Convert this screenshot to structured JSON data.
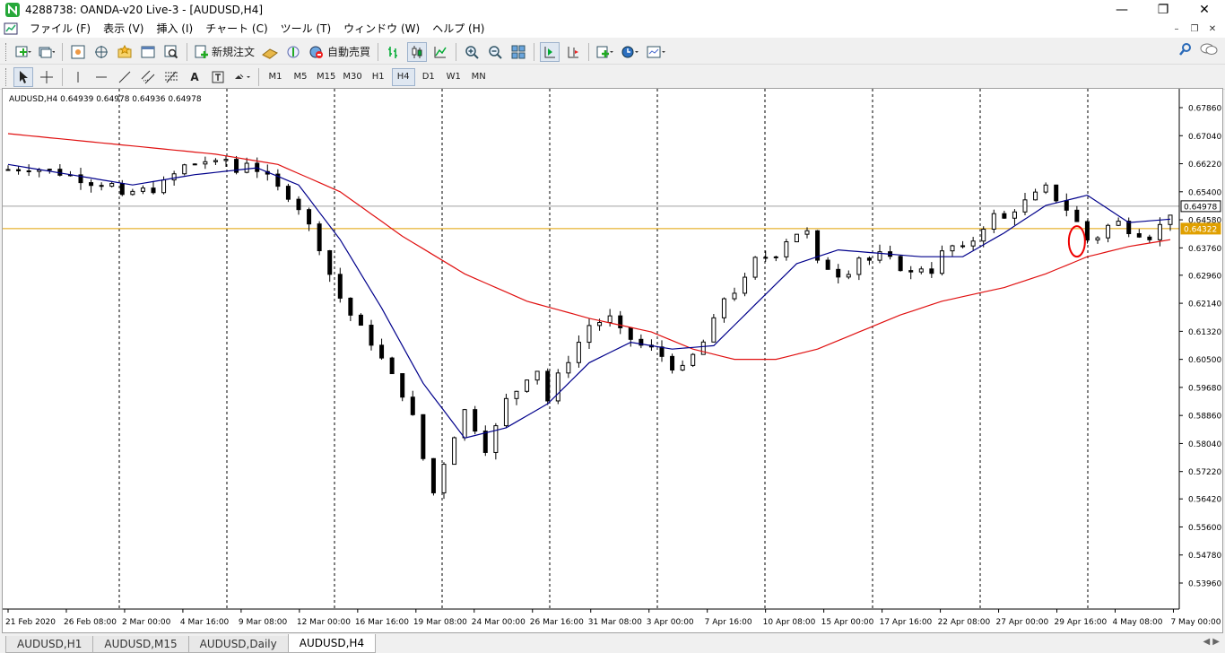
{
  "window": {
    "title": "4288738: OANDA-v20 Live-3 - [AUDUSD,H4]",
    "minimize": "—",
    "maximize": "❐",
    "close": "✕"
  },
  "menu": {
    "items": [
      "ファイル (F)",
      "表示 (V)",
      "挿入 (I)",
      "チャート (C)",
      "ツール (T)",
      "ウィンドウ (W)",
      "ヘルプ (H)"
    ],
    "mdi_minimize": "–",
    "mdi_restore": "❐",
    "mdi_close": "✕"
  },
  "toolbar1": {
    "new_order_label": "新規注文",
    "auto_trading_label": "自動売買"
  },
  "toolbar2": {
    "timeframes": [
      "M1",
      "M5",
      "M15",
      "M30",
      "H1",
      "H4",
      "D1",
      "W1",
      "MN"
    ],
    "active_timeframe": "H4",
    "text_tool": "A"
  },
  "chart_data": {
    "type": "candlestick",
    "symbol_info": "AUDUSD,H4  0.64939 0.64978 0.64936 0.64978",
    "y_ticks": [
      "0.67860",
      "0.67040",
      "0.66220",
      "0.65400",
      "0.64580",
      "0.63760",
      "0.62960",
      "0.62140",
      "0.61320",
      "0.60500",
      "0.59680",
      "0.58860",
      "0.58040",
      "0.57220",
      "0.56420",
      "0.55600",
      "0.54780",
      "0.53960"
    ],
    "ylim": [
      0.5396,
      0.6786
    ],
    "x_ticks": [
      "21 Feb 2020",
      "26 Feb 08:00",
      "2 Mar 00:00",
      "4 Mar 16:00",
      "9 Mar 08:00",
      "12 Mar 00:00",
      "16 Mar 16:00",
      "19 Mar 08:00",
      "24 Mar 00:00",
      "26 Mar 16:00",
      "31 Mar 08:00",
      "3 Apr 00:00",
      "7 Apr 16:00",
      "10 Apr 08:00",
      "15 Apr 00:00",
      "17 Apr 16:00",
      "22 Apr 08:00",
      "27 Apr 00:00",
      "29 Apr 16:00",
      "4 May 08:00",
      "7 May 00:00"
    ],
    "current_price_label": "0.64978",
    "hline_price_label": "0.64322",
    "current_price": 0.64978,
    "hline_price": 0.64322,
    "ma_fast_color": "#00008b",
    "ma_slow_color": "#e01010",
    "hline_color": "#e0a000",
    "price_line_color": "#a0a0a0",
    "close_path": [
      [
        0,
        0.6605
      ],
      [
        2,
        0.661
      ],
      [
        4,
        0.6602
      ],
      [
        6,
        0.6588
      ],
      [
        8,
        0.6568
      ],
      [
        10,
        0.656
      ],
      [
        11,
        0.652
      ],
      [
        12,
        0.654
      ],
      [
        14,
        0.6548
      ],
      [
        15,
        0.6565
      ],
      [
        17,
        0.6615
      ],
      [
        19,
        0.663
      ],
      [
        20,
        0.662
      ],
      [
        21,
        0.6635
      ],
      [
        22,
        0.6598
      ],
      [
        23,
        0.663
      ],
      [
        24,
        0.6605
      ],
      [
        25,
        0.658
      ],
      [
        26,
        0.655
      ],
      [
        27,
        0.653
      ],
      [
        28,
        0.6495
      ],
      [
        29,
        0.644
      ],
      [
        30,
        0.638
      ],
      [
        31,
        0.63
      ],
      [
        32,
        0.623
      ],
      [
        33,
        0.618
      ],
      [
        34,
        0.614
      ],
      [
        35,
        0.61
      ],
      [
        36,
        0.605
      ],
      [
        37,
        0.6
      ],
      [
        38,
        0.595
      ],
      [
        39,
        0.588
      ],
      [
        40,
        0.576
      ],
      [
        41,
        0.566
      ],
      [
        42,
        0.575
      ],
      [
        43,
        0.583
      ],
      [
        44,
        0.59
      ],
      [
        45,
        0.585
      ],
      [
        46,
        0.579
      ],
      [
        47,
        0.585
      ],
      [
        48,
        0.593
      ],
      [
        49,
        0.596
      ],
      [
        50,
        0.6
      ],
      [
        51,
        0.602
      ],
      [
        52,
        0.593
      ],
      [
        53,
        0.6
      ],
      [
        54,
        0.605
      ],
      [
        55,
        0.61
      ],
      [
        56,
        0.615
      ],
      [
        57,
        0.616
      ],
      [
        58,
        0.617
      ],
      [
        59,
        0.613
      ],
      [
        60,
        0.611
      ],
      [
        61,
        0.609
      ],
      [
        62,
        0.608
      ],
      [
        63,
        0.606
      ],
      [
        64,
        0.603
      ],
      [
        65,
        0.602
      ],
      [
        66,
        0.606
      ],
      [
        67,
        0.61
      ],
      [
        68,
        0.616
      ],
      [
        69,
        0.623
      ],
      [
        70,
        0.625
      ],
      [
        71,
        0.628
      ],
      [
        72,
        0.634
      ],
      [
        73,
        0.635
      ],
      [
        74,
        0.636
      ],
      [
        75,
        0.64
      ],
      [
        76,
        0.642
      ],
      [
        77,
        0.642
      ],
      [
        78,
        0.633
      ],
      [
        79,
        0.632
      ],
      [
        80,
        0.63
      ],
      [
        81,
        0.631
      ],
      [
        82,
        0.635
      ],
      [
        83,
        0.634
      ],
      [
        84,
        0.6355
      ],
      [
        85,
        0.634
      ],
      [
        86,
        0.632
      ],
      [
        87,
        0.63
      ],
      [
        88,
        0.632
      ],
      [
        89,
        0.631
      ],
      [
        90,
        0.636
      ],
      [
        91,
        0.638
      ],
      [
        92,
        0.637
      ],
      [
        93,
        0.64
      ],
      [
        94,
        0.644
      ],
      [
        95,
        0.647
      ],
      [
        96,
        0.646
      ],
      [
        97,
        0.649
      ],
      [
        98,
        0.651
      ],
      [
        99,
        0.653
      ],
      [
        100,
        0.655
      ],
      [
        101,
        0.652
      ],
      [
        102,
        0.649
      ],
      [
        103,
        0.645
      ],
      [
        104,
        0.64
      ],
      [
        105,
        0.641
      ],
      [
        106,
        0.644
      ],
      [
        107,
        0.645
      ],
      [
        108,
        0.643
      ],
      [
        109,
        0.642
      ],
      [
        110,
        0.641
      ],
      [
        111,
        0.644
      ],
      [
        112,
        0.648
      ]
    ],
    "ma_fast": [
      [
        0,
        0.662
      ],
      [
        6,
        0.659
      ],
      [
        12,
        0.656
      ],
      [
        18,
        0.659
      ],
      [
        24,
        0.661
      ],
      [
        28,
        0.656
      ],
      [
        32,
        0.64
      ],
      [
        36,
        0.62
      ],
      [
        40,
        0.598
      ],
      [
        44,
        0.582
      ],
      [
        48,
        0.585
      ],
      [
        52,
        0.592
      ],
      [
        56,
        0.604
      ],
      [
        60,
        0.61
      ],
      [
        64,
        0.608
      ],
      [
        68,
        0.609
      ],
      [
        72,
        0.621
      ],
      [
        76,
        0.633
      ],
      [
        80,
        0.637
      ],
      [
        84,
        0.636
      ],
      [
        88,
        0.635
      ],
      [
        92,
        0.635
      ],
      [
        96,
        0.642
      ],
      [
        100,
        0.65
      ],
      [
        104,
        0.653
      ],
      [
        108,
        0.645
      ],
      [
        112,
        0.646
      ]
    ],
    "ma_slow": [
      [
        0,
        0.671
      ],
      [
        10,
        0.668
      ],
      [
        20,
        0.665
      ],
      [
        26,
        0.662
      ],
      [
        32,
        0.654
      ],
      [
        38,
        0.641
      ],
      [
        44,
        0.63
      ],
      [
        50,
        0.622
      ],
      [
        56,
        0.617
      ],
      [
        62,
        0.613
      ],
      [
        66,
        0.608
      ],
      [
        70,
        0.605
      ],
      [
        74,
        0.605
      ],
      [
        78,
        0.608
      ],
      [
        82,
        0.613
      ],
      [
        86,
        0.618
      ],
      [
        90,
        0.622
      ],
      [
        96,
        0.626
      ],
      [
        100,
        0.63
      ],
      [
        104,
        0.635
      ],
      [
        108,
        0.638
      ],
      [
        112,
        0.64
      ]
    ]
  },
  "tabs": [
    "AUDUSD,H1",
    "AUDUSD,M15",
    "AUDUSD,Daily",
    "AUDUSD,H4"
  ],
  "active_tab": "AUDUSD,H4"
}
